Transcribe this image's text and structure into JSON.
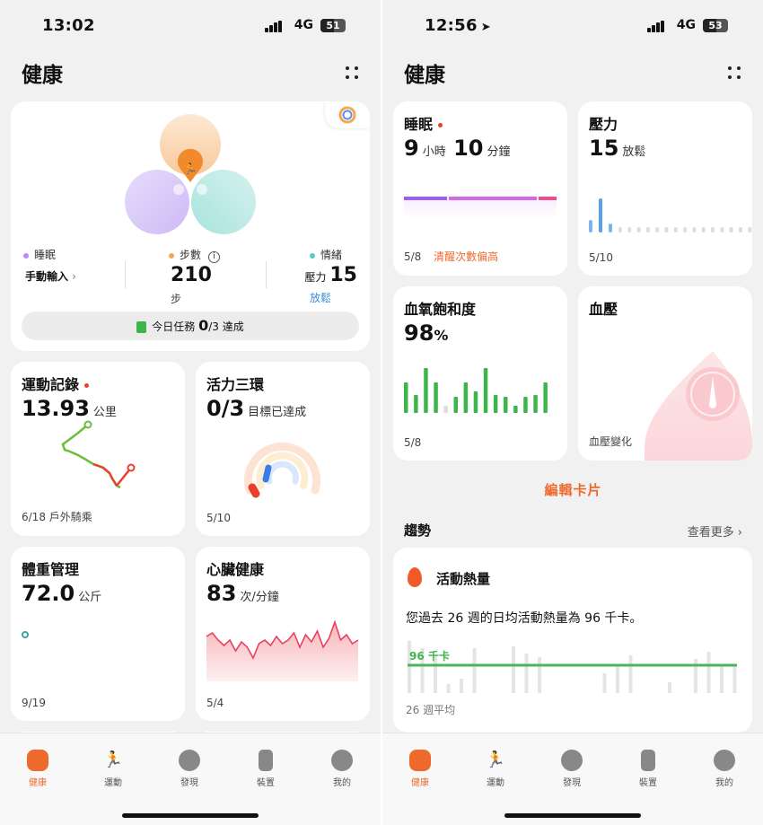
{
  "left": {
    "status_time": "13:02",
    "network": "4G",
    "battery": "51",
    "title": "健康",
    "rings": {
      "sleep_label": "睡眠",
      "sleep_value": "手動輸入",
      "steps_label": "步數",
      "steps_value": "210",
      "steps_unit": "步",
      "mood_label": "情緒",
      "mood_prefix": "壓力",
      "mood_value": "15",
      "mood_state": "放鬆",
      "task_prefix": "今日任務",
      "task_done": "0",
      "task_total": "/3",
      "task_suffix": "達成"
    },
    "workout": {
      "title": "運動記錄",
      "value": "13.93",
      "unit": "公里",
      "footer": "6/18 戶外騎乘"
    },
    "activity": {
      "title": "活力三環",
      "value": "0/3",
      "unit": "目標已達成",
      "footer": "5/10"
    },
    "weight": {
      "title": "體重管理",
      "value": "72.0",
      "unit": "公斤",
      "footer": "9/19"
    },
    "heart": {
      "title": "心臟健康",
      "value": "83",
      "unit": "次/分鐘",
      "footer": "5/4"
    }
  },
  "right": {
    "status_time": "12:56",
    "network": "4G",
    "battery": "53",
    "title": "健康",
    "sleep": {
      "title": "睡眠",
      "hours": "9",
      "hours_unit": "小時",
      "mins": "10",
      "mins_unit": "分鐘",
      "date": "5/8",
      "note": "清醒次數偏高"
    },
    "stress": {
      "title": "壓力",
      "value": "15",
      "state": "放鬆",
      "footer": "5/10"
    },
    "spo2": {
      "title": "血氧飽和度",
      "value": "98",
      "unit": "%",
      "footer": "5/8"
    },
    "bp": {
      "title": "血壓",
      "footer": "血壓變化"
    },
    "edit_cards": "編輯卡片",
    "trends": {
      "label": "趨勢",
      "more": "查看更多",
      "card_title": "活動熱量",
      "summary": "您過去 26 週的日均活動熱量為 96 千卡。",
      "line_label": "96 千卡",
      "footer": "26 週平均"
    }
  },
  "tabs": [
    "健康",
    "運動",
    "發現",
    "裝置",
    "我的"
  ],
  "colors": {
    "accent": "#ee6a2c",
    "sleep": "#b48ef5",
    "steps": "#f5a65b",
    "mood": "#5cc9c3",
    "green": "#3cb64a",
    "red": "#e8402d"
  }
}
